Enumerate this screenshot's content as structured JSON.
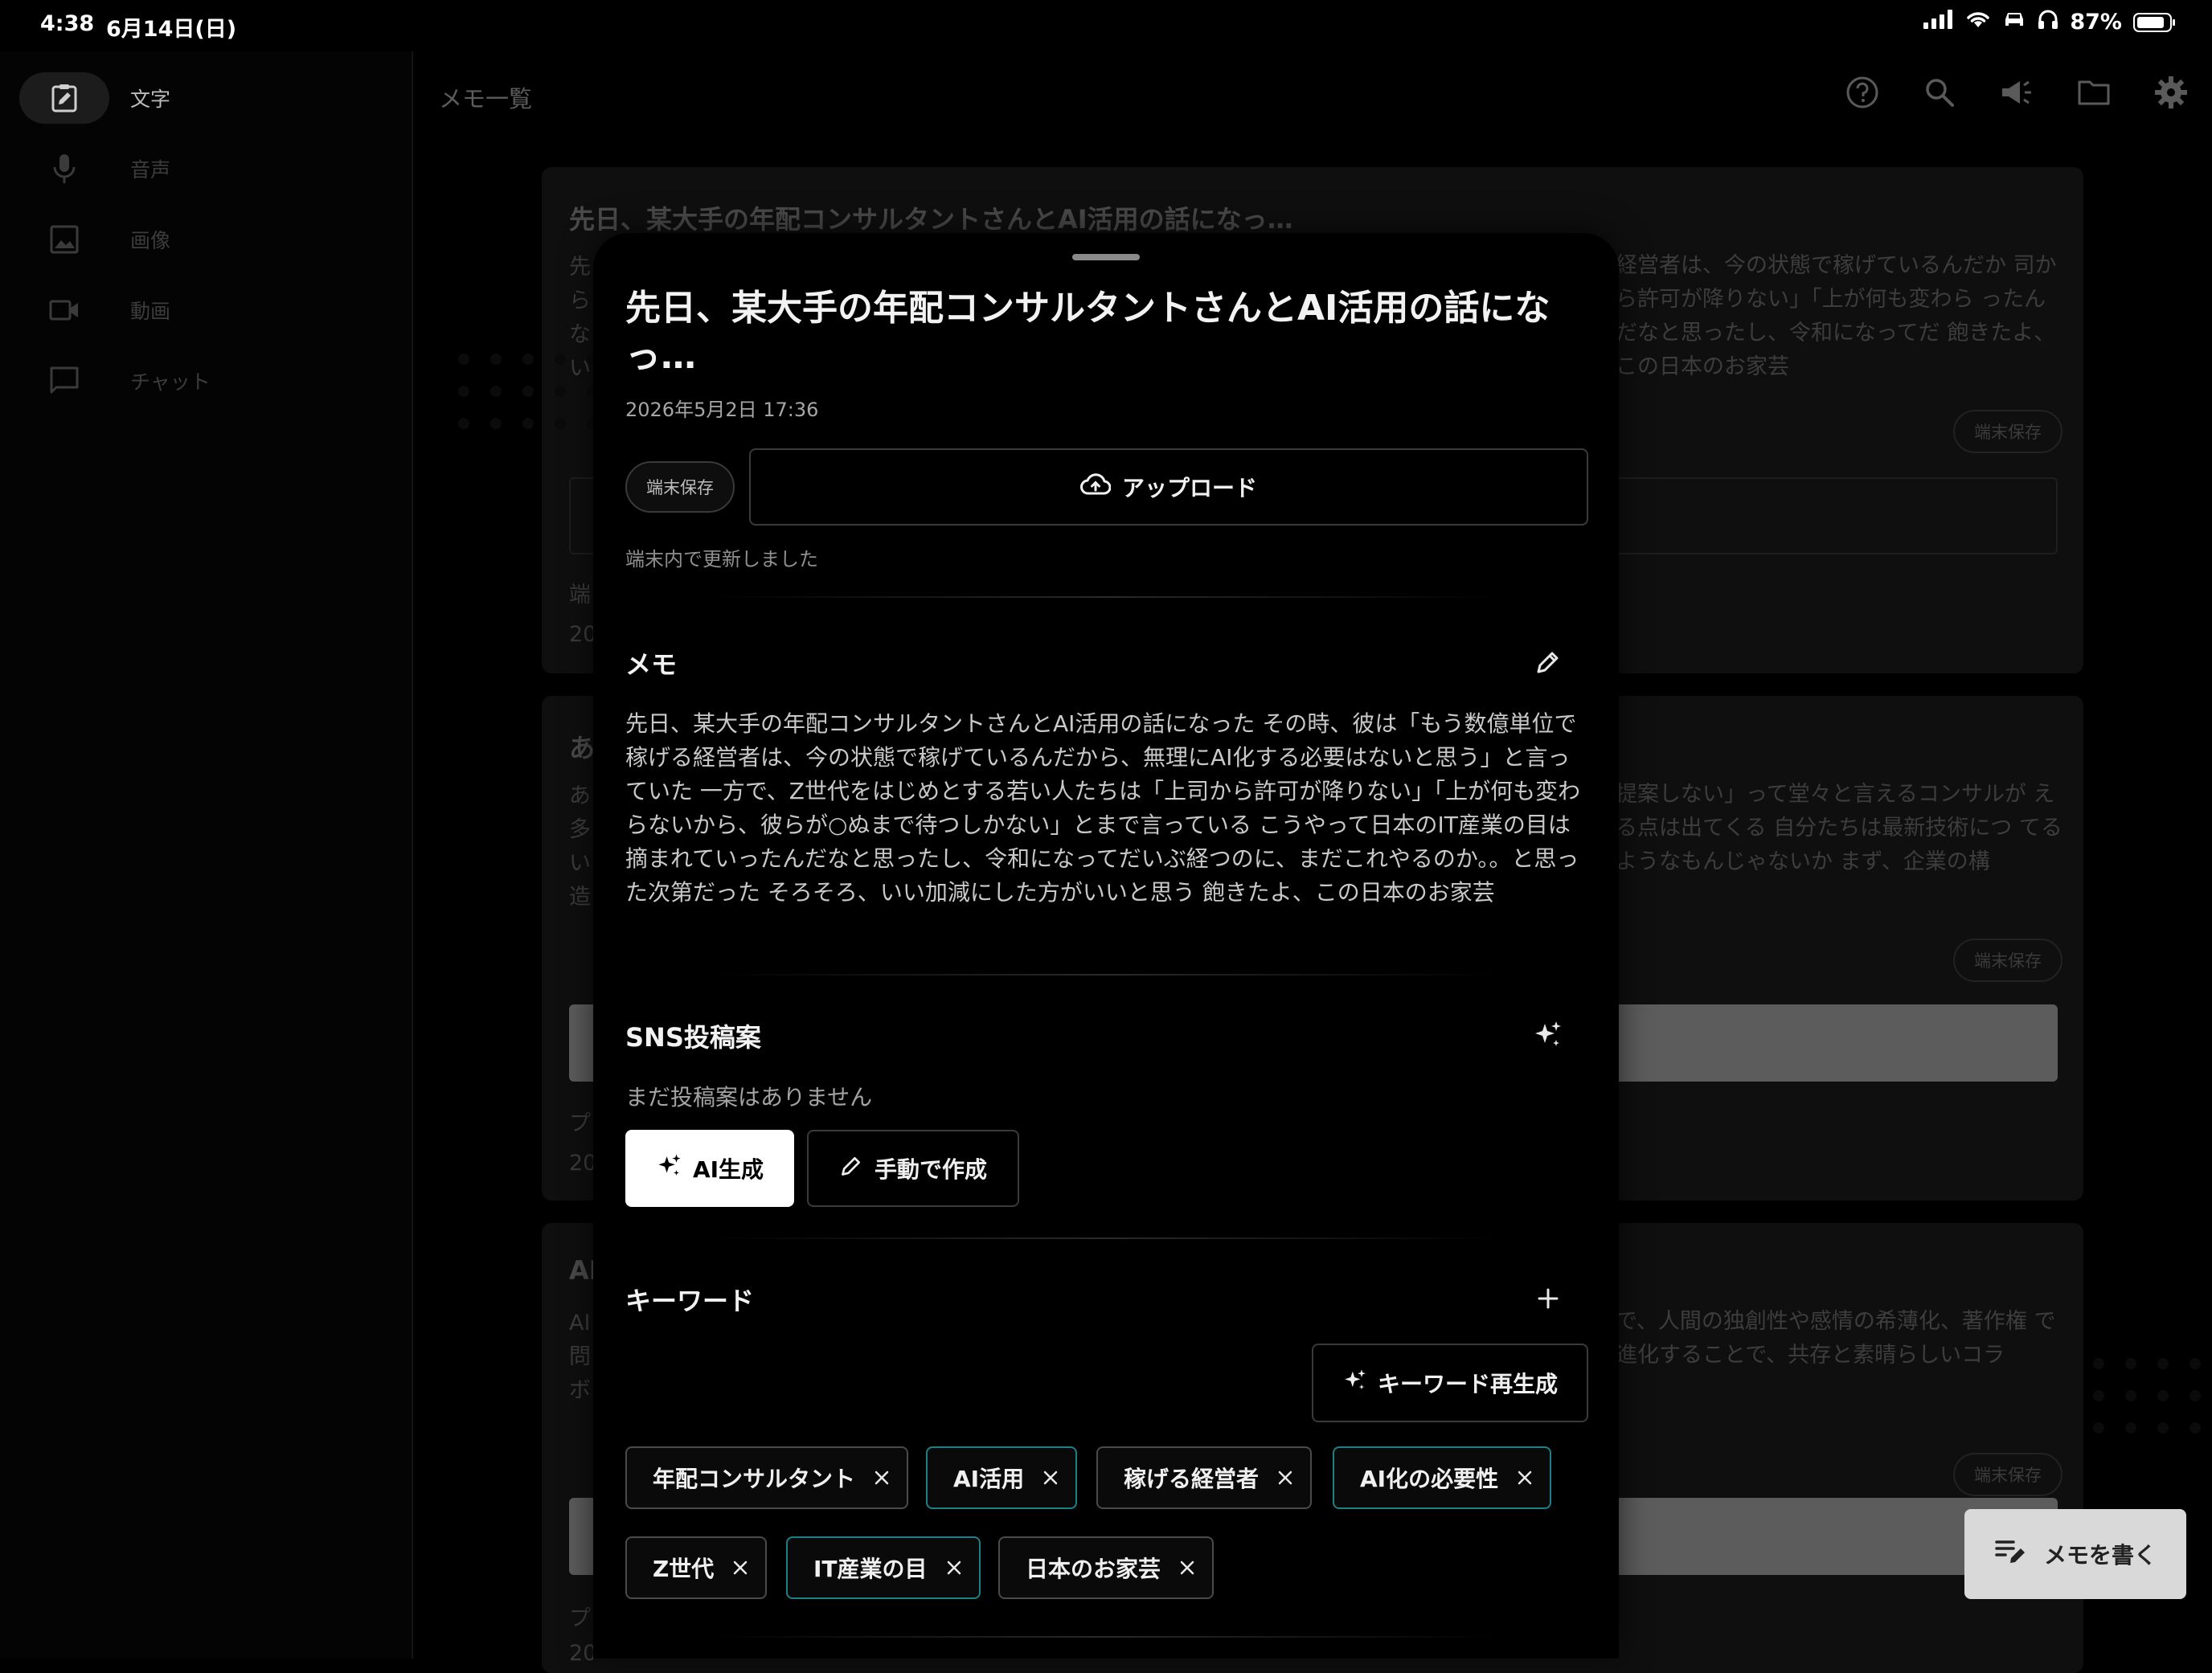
{
  "status_bar": {
    "time": "4:38",
    "date": "6月14日(日)",
    "battery": "87%",
    "battery_level": 0.87
  },
  "sidebar": {
    "items": [
      {
        "label": "文字",
        "icon": "text-memo-icon",
        "active": true
      },
      {
        "label": "音声",
        "icon": "microphone-icon",
        "active": false
      },
      {
        "label": "画像",
        "icon": "image-icon",
        "active": false
      },
      {
        "label": "動画",
        "icon": "video-icon",
        "active": false
      },
      {
        "label": "チャット",
        "icon": "chat-icon",
        "active": false
      }
    ]
  },
  "header": {
    "title": "メモ一覧",
    "icons": [
      "help-icon",
      "search-icon",
      "megaphone-icon",
      "folder-icon",
      "settings-icon"
    ]
  },
  "background_cards": [
    {
      "title": "先日、某大手の年配コンサルタントさんとAI活用の話になっ…",
      "text_left": [
        "先",
        "ら",
        "な",
        "い"
      ],
      "text_right": "経営者は、今の状態で稼げているんだか 司から許可が降りない」「上が何も変わら ったんだなと思ったし、令和になってだ 飽きたよ、この日本のお家芸",
      "pill": "端末保存",
      "line_a": "端",
      "line_b": "20"
    },
    {
      "title": "あ",
      "text_left": [
        "あ",
        "多",
        "い",
        "造"
      ],
      "text_right": "提案しない」って堂々と言えるコンサルが える点は出てくる 自分たちは最新技術につ てるようなもんじゃないか まず、企業の構",
      "pill": "端末保存",
      "line_a": "プ",
      "line_b": "20"
    },
    {
      "title": "AI",
      "text_left": [
        "AI",
        "問",
        "ボ"
      ],
      "text_right": "で、人間の独創性や感情の希薄化、著作権 で進化することで、共存と素晴らしいコラ",
      "pill": "端末保存",
      "line_a": "プ",
      "line_b": "20"
    }
  ],
  "modal": {
    "title": "先日、某大手の年配コンサルタントさんとAI活用の話になっ…",
    "date": "2026年5月2日 17:36",
    "storage_pill": "端末保存",
    "upload_label": "アップロード",
    "updated_note": "端末内で更新しました",
    "memo": {
      "heading": "メモ",
      "body": "先日、某大手の年配コンサルタントさんとAI活用の話になった その時、彼は「もう数億単位で稼げる経営者は、今の状態で稼げているんだから、無理にAI化する必要はないと思う」と言っていた 一方で、Z世代をはじめとする若い人たちは「上司から許可が降りない」「上が何も変わらないから、彼らが○ぬまで待つしかない」とまで言っている こうやって日本のIT産業の目は摘まれていったんだなと思ったし、令和になってだいぶ経つのに、まだこれやるのか。。と思った次第だった そろそろ、いい加減にした方がいいと思う 飽きたよ、この日本のお家芸"
    },
    "sns": {
      "heading": "SNS投稿案",
      "empty": "まだ投稿案はありません",
      "ai_button": "AI生成",
      "manual_button": "手動で作成"
    },
    "keywords": {
      "heading": "キーワード",
      "regen_button": "キーワード再生成",
      "chips": [
        {
          "label": "年配コンサルタント",
          "ai": false
        },
        {
          "label": "AI活用",
          "ai": true
        },
        {
          "label": "稼げる経営者",
          "ai": false
        },
        {
          "label": "AI化の必要性",
          "ai": true
        },
        {
          "label": "Z世代",
          "ai": false
        },
        {
          "label": "IT産業の目",
          "ai": true
        },
        {
          "label": "日本のお家芸",
          "ai": false
        }
      ]
    }
  },
  "fab": {
    "label": "メモを書く"
  },
  "colors": {
    "background": "#000000",
    "chip_ai_border": "#1f7f86",
    "fab_bg": "#d9d9d9",
    "sidebar_active_bg": "#1c1c1c"
  }
}
